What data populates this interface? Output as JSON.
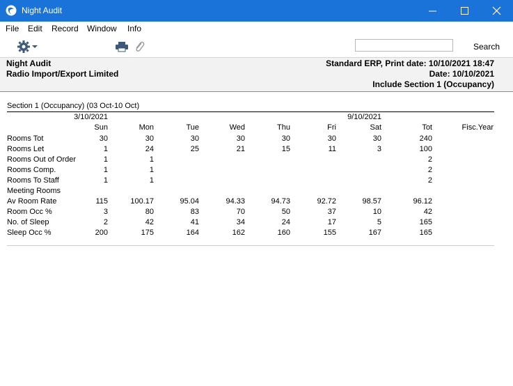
{
  "window": {
    "title": "Night Audit"
  },
  "menu": [
    "File",
    "Edit",
    "Record",
    "Window",
    "Info"
  ],
  "toolbar": {
    "search_label": "Search",
    "search_value": ""
  },
  "report_header": {
    "left_line1": "Night Audit",
    "left_line2": "Radio Import/Export Limited",
    "right_line1": "Standard ERP, Print date: 10/10/2021 18:47",
    "right_line2": "Date: 10/10/2021",
    "right_line3": "Include Section 1 (Occupancy)"
  },
  "report": {
    "section_title": "Section 1 (Occupancy) (03 Oct-10 Oct)",
    "week_label_1": "3/10/2021",
    "week_label_2": "9/10/2021",
    "columns": [
      "Sun",
      "Mon",
      "Tue",
      "Wed",
      "Thu",
      "Fri",
      "Sat",
      "Tot",
      "Fisc.Year"
    ],
    "rows": [
      {
        "label": "Rooms Tot",
        "values": [
          "30",
          "30",
          "30",
          "30",
          "30",
          "30",
          "30",
          "240",
          ""
        ]
      },
      {
        "label": "Rooms Let",
        "values": [
          "1",
          "24",
          "25",
          "21",
          "15",
          "11",
          "3",
          "100",
          ""
        ]
      },
      {
        "label": "Rooms Out of Order",
        "values": [
          "1",
          "1",
          "",
          "",
          "",
          "",
          "",
          "2",
          ""
        ]
      },
      {
        "label": "Rooms Comp.",
        "values": [
          "1",
          "1",
          "",
          "",
          "",
          "",
          "",
          "2",
          ""
        ]
      },
      {
        "label": "Rooms To Staff",
        "values": [
          "1",
          "1",
          "",
          "",
          "",
          "",
          "",
          "2",
          ""
        ]
      },
      {
        "label": "Meeting Rooms",
        "values": [
          "",
          "",
          "",
          "",
          "",
          "",
          "",
          "",
          ""
        ]
      },
      {
        "label": "Av Room Rate",
        "values": [
          "115",
          "100.17",
          "95.04",
          "94.33",
          "94.73",
          "92.72",
          "98.57",
          "96.12",
          ""
        ]
      },
      {
        "label": "Room Occ %",
        "values": [
          "3",
          "80",
          "83",
          "70",
          "50",
          "37",
          "10",
          "42",
          ""
        ]
      },
      {
        "label": "No. of Sleep",
        "values": [
          "2",
          "42",
          "41",
          "34",
          "24",
          "17",
          "5",
          "165",
          ""
        ]
      },
      {
        "label": "Sleep Occ %",
        "values": [
          "200",
          "175",
          "164",
          "162",
          "160",
          "155",
          "167",
          "165",
          ""
        ]
      }
    ]
  }
}
